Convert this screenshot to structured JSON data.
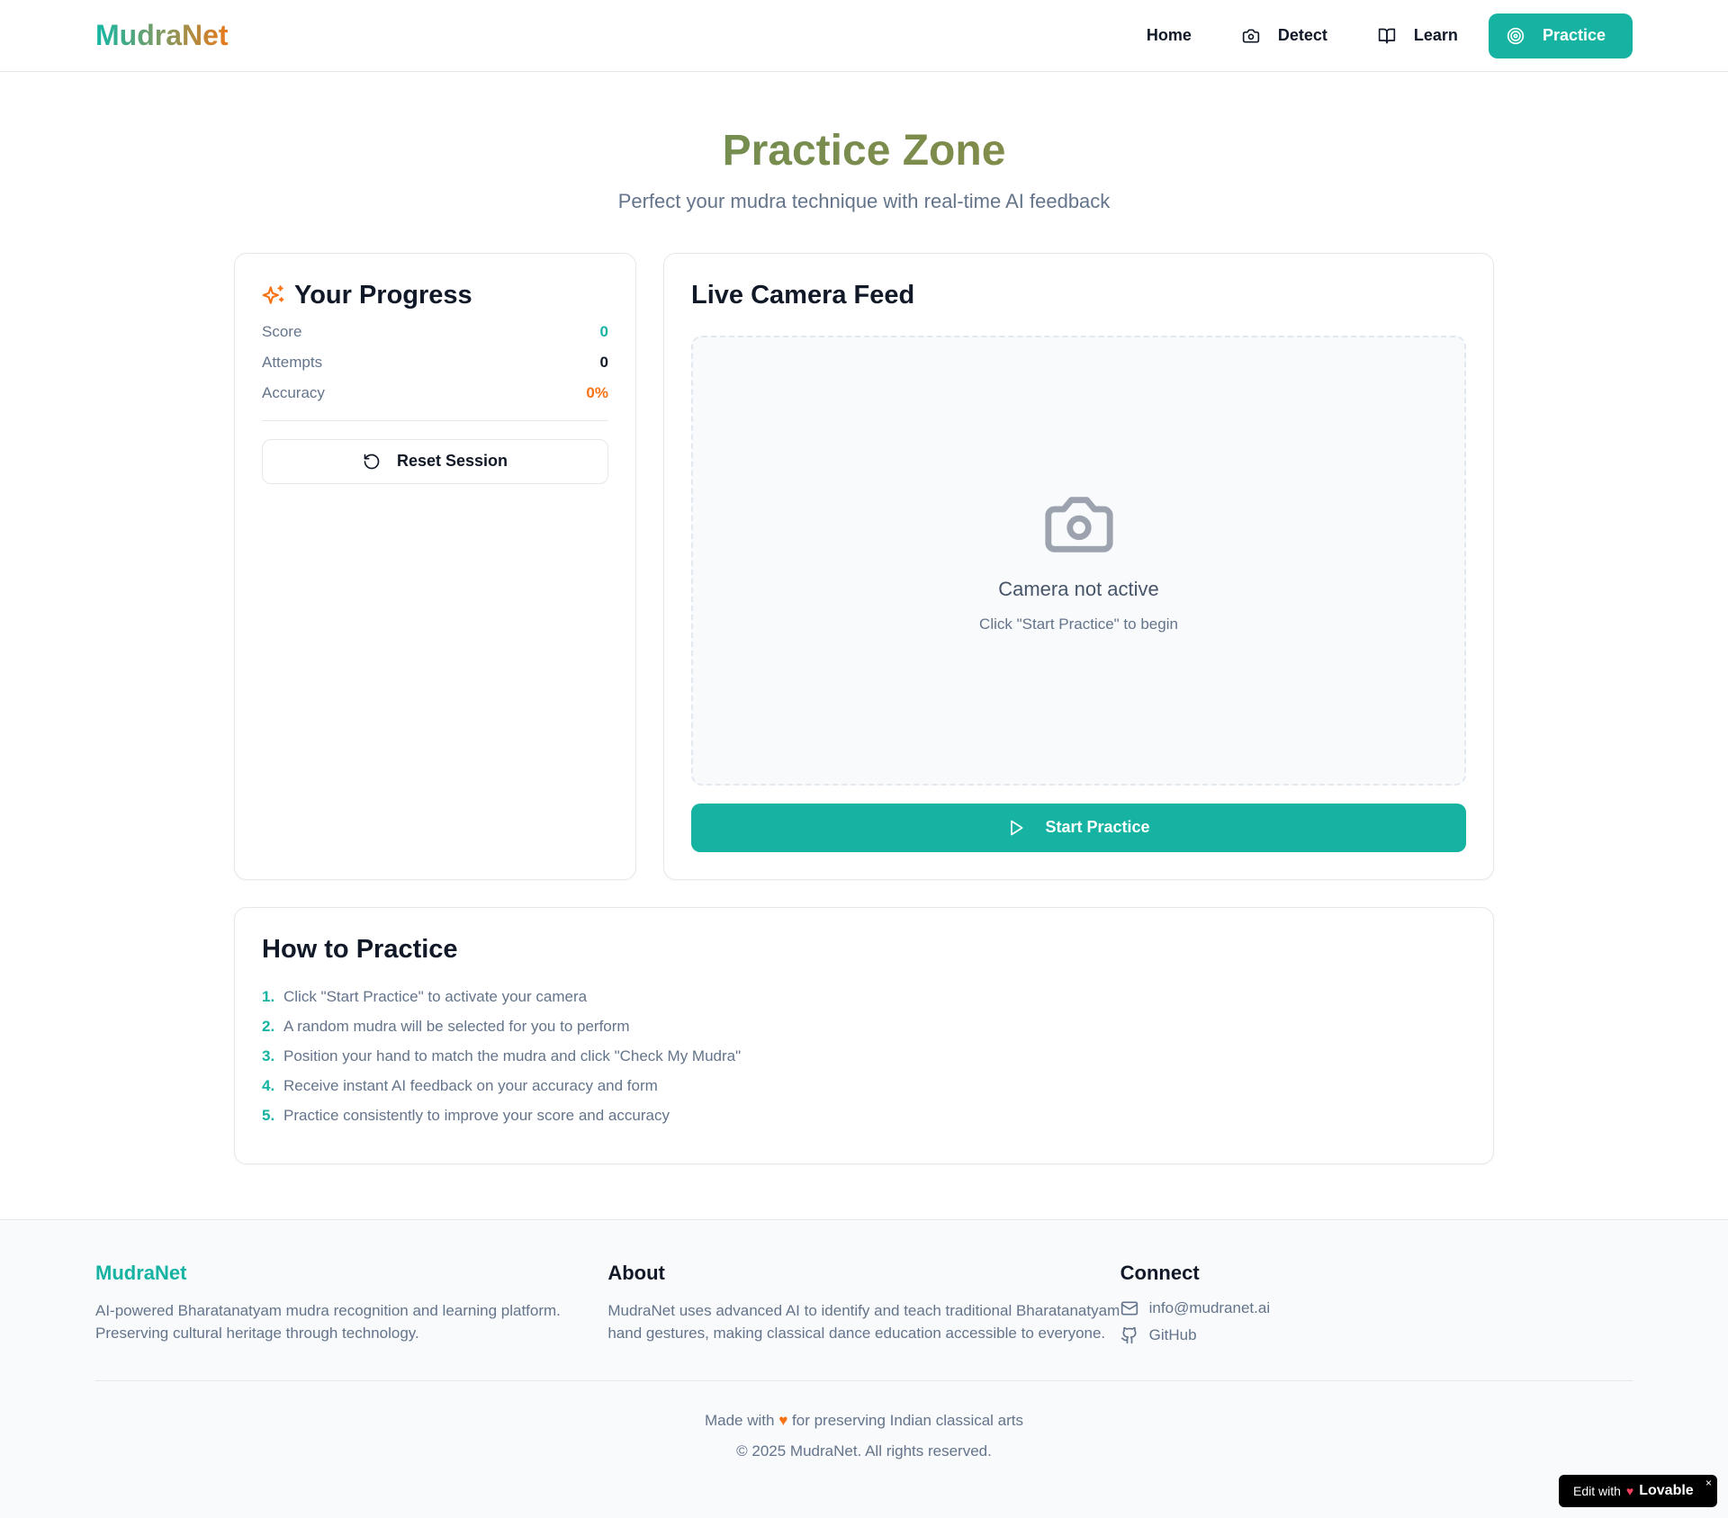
{
  "nav": {
    "logo": "MudraNet",
    "links": [
      {
        "label": "Home",
        "icon": "none"
      },
      {
        "label": "Detect",
        "icon": "camera-icon"
      },
      {
        "label": "Learn",
        "icon": "book-icon"
      },
      {
        "label": "Practice",
        "icon": "target-icon"
      }
    ],
    "active": "Practice"
  },
  "hero": {
    "title": "Practice Zone",
    "subtitle": "Perfect your mudra technique with real-time AI feedback"
  },
  "progress": {
    "title": "Your Progress",
    "stats": [
      {
        "label": "Score",
        "value": "0",
        "color": "#16b3a3"
      },
      {
        "label": "Attempts",
        "value": "0",
        "color": "#111827"
      },
      {
        "label": "Accuracy",
        "value": "0%",
        "color": "#f97316"
      }
    ],
    "reset_label": "Reset Session"
  },
  "camera": {
    "title": "Live Camera Feed",
    "status": "Camera not active",
    "hint": "Click \"Start Practice\" to begin",
    "start_label": "Start Practice"
  },
  "howto": {
    "title": "How to Practice",
    "steps": [
      {
        "n": "1.",
        "text": "Click \"Start Practice\" to activate your camera"
      },
      {
        "n": "2.",
        "text": "A random mudra will be selected for you to perform"
      },
      {
        "n": "3.",
        "text": "Position your hand to match the mudra and click \"Check My Mudra\""
      },
      {
        "n": "4.",
        "text": "Receive instant AI feedback on your accuracy and form"
      },
      {
        "n": "5.",
        "text": "Practice consistently to improve your score and accuracy"
      }
    ]
  },
  "footer": {
    "brand": "MudraNet",
    "brand_desc": "AI-powered Bharatanatyam mudra recognition and learning platform. Preserving cultural heritage through technology.",
    "about_title": "About",
    "about_desc": "MudraNet uses advanced AI to identify and teach traditional Bharatanatyam hand gestures, making classical dance education accessible to everyone.",
    "connect_title": "Connect",
    "email": "info@mudranet.ai",
    "github": "GitHub",
    "made_with_pre": "Made with",
    "made_with_post": "for preserving Indian classical arts",
    "copyright": "© 2025 MudraNet. All rights reserved."
  },
  "badge": {
    "pre": "Edit with",
    "brand": "Lovable",
    "close": "×"
  },
  "colors": {
    "accent": "#16b3a3",
    "orange": "#f97316"
  }
}
